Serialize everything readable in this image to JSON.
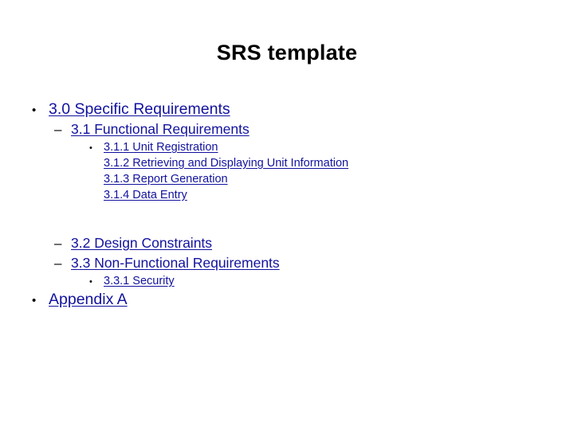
{
  "slide": {
    "title": "SRS template",
    "background_color": "#ffffff",
    "title_color": "#000000",
    "link_color": "#12129e",
    "bullet_color": "#000000"
  },
  "outline": [
    {
      "level": 1,
      "bullet": "•",
      "text": "3.0 Specific Requirements",
      "underlined": true
    },
    {
      "level": 2,
      "bullet": "–",
      "text": "3.1 Functional Requirements",
      "underlined": true
    },
    {
      "level": 3,
      "bullet": "•",
      "text": "3.1.1 Unit Registration",
      "underlined": true
    },
    {
      "level": 3,
      "bullet": "",
      "text": "3.1.2  Retrieving and Displaying Unit Information",
      "underlined": true
    },
    {
      "level": 3,
      "bullet": "",
      "text": "3.1.3  Report Generation",
      "underlined": true
    },
    {
      "level": 3,
      "bullet": "",
      "text": "3.1.4 Data Entry",
      "underlined": true
    },
    {
      "level": 2,
      "bullet": "–",
      "text": "3.2 Design Constraints",
      "underlined": true
    },
    {
      "level": 2,
      "bullet": "–",
      "text": "3.3 Non-Functional Requirements",
      "underlined": true
    },
    {
      "level": 3,
      "bullet": "•",
      "text": "3.3.1 Security",
      "underlined": true
    },
    {
      "level": 1,
      "bullet": "•",
      "text": "Appendix A",
      "underlined": true
    }
  ]
}
